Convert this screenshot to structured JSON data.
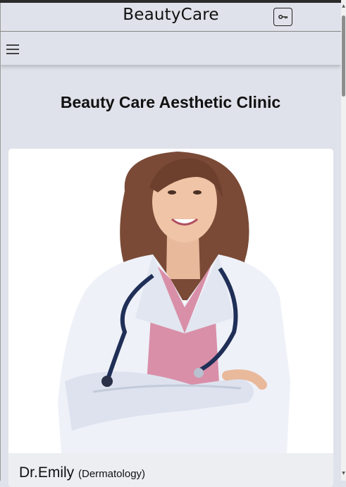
{
  "header": {
    "brand": "BeautyCare",
    "login_icon": "key-icon"
  },
  "navbar": {
    "menu_icon": "hamburger-menu-icon"
  },
  "main": {
    "title": "Beauty Care Aesthetic Clinic"
  },
  "doctor_card": {
    "photo": "doctor-photo",
    "name": "Dr.Emily",
    "specialty": "(Dermatology)"
  },
  "colors": {
    "page_bg": "#dfe2ea",
    "card_footer_bg": "#eceef2",
    "coat": "#eef1f8",
    "scrub": "#d98fa8",
    "stethoscope": "#1f2f57",
    "hair": "#7a4a36"
  }
}
